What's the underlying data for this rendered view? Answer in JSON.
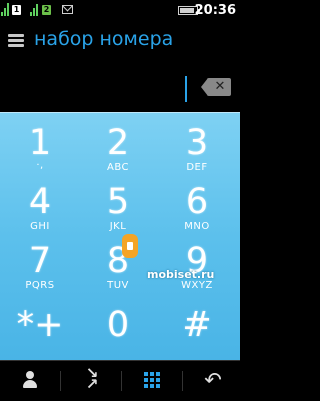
{
  "status": {
    "sim1": "1",
    "sim2": "2",
    "time": "20:36"
  },
  "header": {
    "title": "набор номера"
  },
  "keypad": {
    "keys": [
      {
        "digit": "1",
        "letters": "·,"
      },
      {
        "digit": "2",
        "letters": "ABC"
      },
      {
        "digit": "3",
        "letters": "DEF"
      },
      {
        "digit": "4",
        "letters": "GHI"
      },
      {
        "digit": "5",
        "letters": "JKL"
      },
      {
        "digit": "6",
        "letters": "MNO"
      },
      {
        "digit": "7",
        "letters": "PQRS"
      },
      {
        "digit": "8",
        "letters": "TUV"
      },
      {
        "digit": "9",
        "letters": "WXYZ"
      },
      {
        "digit": "*+",
        "letters": ""
      },
      {
        "digit": "0",
        "letters": ""
      },
      {
        "digit": "#",
        "letters": ""
      }
    ]
  },
  "toolbar": {
    "icons": [
      "contacts-icon",
      "call-log-icon",
      "keypad-icon",
      "back-icon"
    ]
  },
  "watermark": "mobiset.ru"
}
